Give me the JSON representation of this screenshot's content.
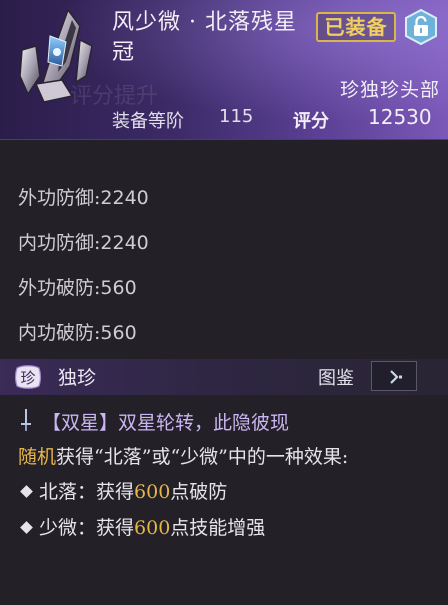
{
  "item": {
    "name": "风少微 · 北落残星冠",
    "equipped_badge": "已装备",
    "slot_type": "珍独珍头部",
    "level_label": "装备等阶",
    "level_value": "115",
    "score_label": "评分",
    "score_value": "12530",
    "watermark": "评分提升"
  },
  "stats": [
    {
      "label": "外功防御:",
      "value": "2240"
    },
    {
      "label": "内功防御:",
      "value": "2240"
    },
    {
      "label": "外功破防:",
      "value": "560"
    },
    {
      "label": "内功破防:",
      "value": "560"
    }
  ],
  "rarity": {
    "icon_text": "珍",
    "label": "独珍",
    "atlas_label": "图鉴"
  },
  "description": {
    "set_line": "【双星】双星轮转，此隐彼现",
    "random_prefix": "随机",
    "random_rest": "获得“北落”或“少微”中的一种效果:",
    "effects": [
      {
        "name": "北落",
        "pre": "：获得",
        "value": "600",
        "post": "点破防"
      },
      {
        "name": "少微",
        "pre": "：获得",
        "value": "600",
        "post": "点技能增强"
      }
    ]
  },
  "colors": {
    "accent_gold": "#e7b54a",
    "badge_gold": "#f0cf5e",
    "set_purple": "#c9b6f2",
    "header_purple": "#5a3f93"
  },
  "icons": [
    "crown-item-icon",
    "lock-icon",
    "rarity-seal-icon",
    "chevron-right-icon",
    "sword-icon",
    "diamond-bullet-icon"
  ]
}
